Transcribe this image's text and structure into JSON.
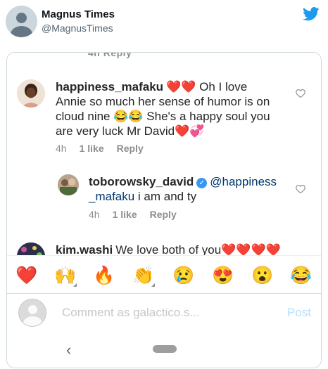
{
  "tweet": {
    "name": "Magnus Times",
    "handle": "@MagnusTimes"
  },
  "screenshot": {
    "cut_text": "4h     Reply",
    "comments": [
      {
        "username": "happiness_mafaku",
        "text": "❤️❤️ Oh I love Annie so much her sense of humor is on cloud nine 😂😂 She's a happy soul you are very luck Mr David❤️💞",
        "time": "4h",
        "likes": "1 like",
        "reply": "Reply"
      },
      {
        "username": "toborowsky_david",
        "verified_mark": "✓",
        "mention": "@happiness _mafaku",
        "text": " i am and ty",
        "time": "4h",
        "likes": "1 like",
        "reply": "Reply"
      },
      {
        "username": "kim.washi",
        "text": "We love both of you❤️❤️❤️❤️"
      }
    ],
    "emojis": [
      "❤️",
      "🙌",
      "🔥",
      "👏",
      "😢",
      "😍",
      "😮",
      "😂"
    ],
    "comment_placeholder": "Comment as galactico.s...",
    "post_label": "Post",
    "nav_back": "‹"
  },
  "colors": {
    "twitter_blue": "#1d9bf0",
    "mention_blue": "#00376b",
    "post_disabled": "#b2dffc",
    "meta_gray": "#8e8e8e"
  },
  "icons": {
    "brand": "twitter-bird-icon",
    "like": "heart-outline-icon",
    "verified": "verified-badge-icon"
  }
}
